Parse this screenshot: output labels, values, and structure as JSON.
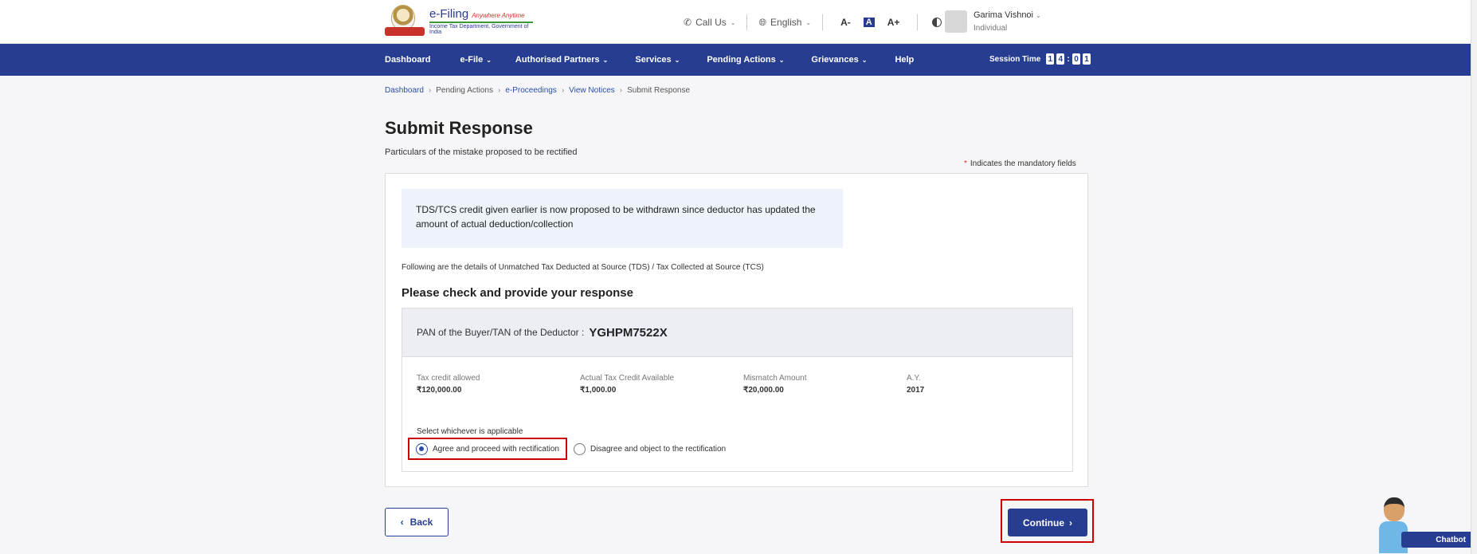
{
  "header": {
    "logo_title": "e-Filing",
    "logo_tagline": "Anywhere Anytime",
    "logo_subtitle": "Income Tax Department, Government of India",
    "call_us": "Call Us",
    "language": "English",
    "font_decrease": "A-",
    "font_normal": "A",
    "font_increase": "A+",
    "user_name": "Garima Vishnoi",
    "user_role": "Individual"
  },
  "nav": {
    "items": [
      {
        "label": "Dashboard",
        "dropdown": false
      },
      {
        "label": "e-File",
        "dropdown": true
      },
      {
        "label": "Authorised Partners",
        "dropdown": true
      },
      {
        "label": "Services",
        "dropdown": true
      },
      {
        "label": "Pending Actions",
        "dropdown": true
      },
      {
        "label": "Grievances",
        "dropdown": true
      },
      {
        "label": "Help",
        "dropdown": false
      }
    ],
    "session_label": "Session Time",
    "session_digits": [
      "1",
      "4",
      "0",
      "1"
    ]
  },
  "breadcrumb": [
    "Dashboard",
    "Pending Actions",
    "e-Proceedings",
    "View Notices",
    "Submit Response"
  ],
  "page": {
    "title": "Submit Response",
    "subtitle": "Particulars of the mistake proposed to be rectified",
    "mandatory_star": "*",
    "mandatory_note": "Indicates the mandatory fields",
    "info_text": "TDS/TCS credit given earlier is now proposed to be withdrawn since deductor has updated the amount of actual deduction/collection",
    "following_text": "Following are the details of Unmatched Tax Deducted at Source (TDS) / Tax Collected at Source (TCS)",
    "respond_title": "Please check and provide your response",
    "pan_label": "PAN of the Buyer/TAN of the Deductor :",
    "pan_value": "YGHPM7522X",
    "columns": [
      {
        "label": "Tax credit allowed",
        "value": "₹120,000.00"
      },
      {
        "label": "Actual Tax Credit Available",
        "value": "₹1,000.00"
      },
      {
        "label": "Mismatch Amount",
        "value": "₹20,000.00"
      },
      {
        "label": "A.Y.",
        "value": "2017"
      }
    ],
    "select_label": "Select whichever is applicable",
    "option_agree": "Agree and proceed with rectification",
    "option_disagree": "Disagree and object to the rectification",
    "selected_option": "agree"
  },
  "buttons": {
    "back": "Back",
    "continue": "Continue"
  },
  "chatbot": {
    "label": "Chatbot"
  },
  "colors": {
    "primary": "#263d91",
    "highlight": "#cc0000",
    "info_bg": "#eef2fa"
  }
}
